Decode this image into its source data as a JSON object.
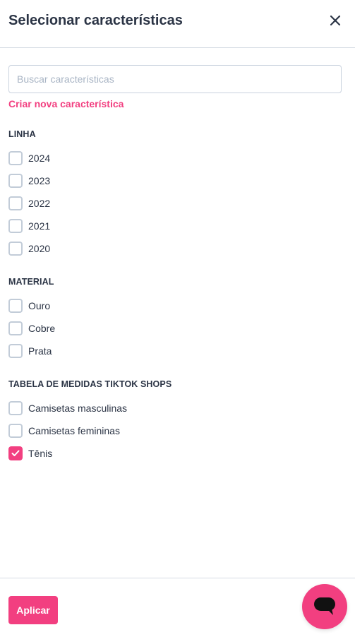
{
  "header": {
    "title": "Selecionar características",
    "close_icon": "close-icon"
  },
  "search": {
    "placeholder": "Buscar características",
    "value": ""
  },
  "create_link": "Criar nova característica",
  "groups": [
    {
      "title": "LINHA",
      "options": [
        {
          "label": "2024",
          "checked": false
        },
        {
          "label": "2023",
          "checked": false
        },
        {
          "label": "2022",
          "checked": false
        },
        {
          "label": "2021",
          "checked": false
        },
        {
          "label": "2020",
          "checked": false
        }
      ]
    },
    {
      "title": "MATERIAL",
      "options": [
        {
          "label": "Ouro",
          "checked": false
        },
        {
          "label": "Cobre",
          "checked": false
        },
        {
          "label": "Prata",
          "checked": false
        }
      ]
    },
    {
      "title": "TABELA DE MEDIDAS TIKTOK SHOPS",
      "options": [
        {
          "label": "Camisetas masculinas",
          "checked": false
        },
        {
          "label": "Camisetas femininas",
          "checked": false
        },
        {
          "label": "Tênis",
          "checked": true
        }
      ]
    }
  ],
  "footer": {
    "apply_label": "Aplicar"
  },
  "chat": {
    "icon": "chat-bubble-icon"
  },
  "colors": {
    "accent": "#f23f80",
    "text": "#2b3445",
    "border": "#c2ccd8"
  }
}
